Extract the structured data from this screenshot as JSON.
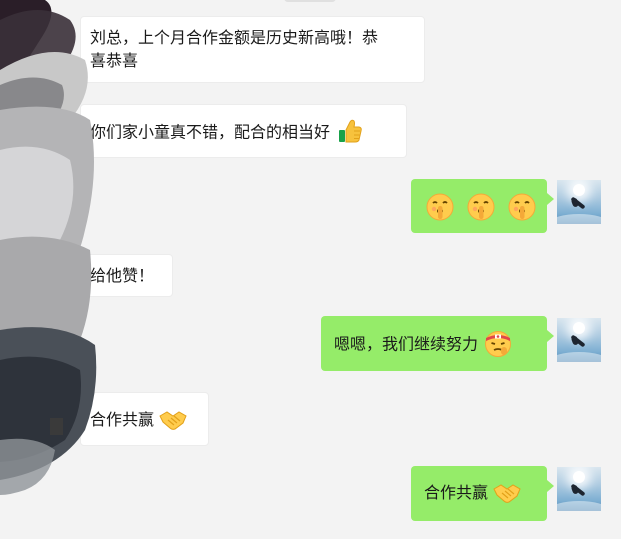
{
  "messages": [
    {
      "side": "in",
      "text_line1": "刘总，上个月合作金额是历史新高哦！恭",
      "text_line2": "喜恭喜"
    },
    {
      "side": "in",
      "text": "你们家小童真不错，配合的相当好",
      "emoji": "thumbs-up-icon"
    },
    {
      "side": "out",
      "emojis": [
        "shushing-face-icon",
        "shushing-face-icon",
        "shushing-face-icon"
      ]
    },
    {
      "side": "in",
      "text": "给他赞！"
    },
    {
      "side": "out",
      "text": "嗯嗯，我们继续努力",
      "emoji": "determined-face-headband-icon"
    },
    {
      "side": "in",
      "text": "合作共赢",
      "emoji": "handshake-icon"
    },
    {
      "side": "out",
      "text": "合作共赢",
      "emoji": "handshake-icon"
    }
  ],
  "colors": {
    "background": "#f3f3f3",
    "incoming_bubble": "#ffffff",
    "outgoing_bubble": "#95ec69",
    "text": "#1a1a1a"
  },
  "avatar": "seagull-sky-avatar"
}
